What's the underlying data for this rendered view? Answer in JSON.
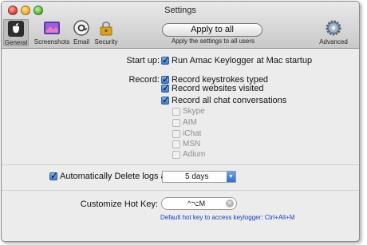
{
  "window": {
    "title": "Settings"
  },
  "toolbar": {
    "items": [
      {
        "label": "General",
        "icon": "apple-icon"
      },
      {
        "label": "Screenshots",
        "icon": "screenshot-icon"
      },
      {
        "label": "Email",
        "icon": "email-icon"
      },
      {
        "label": "Security",
        "icon": "lock-icon"
      },
      {
        "label": "Advanced",
        "icon": "gear-icon"
      }
    ],
    "apply_label": "Apply to all",
    "apply_caption": "Apply the settings to all users"
  },
  "startup": {
    "label": "Start up:",
    "option": "Run Amac Keylogger at Mac startup",
    "checked": true
  },
  "record": {
    "label": "Record:",
    "options": [
      {
        "label": "Record keystrokes typed",
        "checked": true
      },
      {
        "label": "Record websites visited",
        "checked": true
      },
      {
        "label": "Record all chat conversations",
        "checked": true
      }
    ],
    "chat_apps": [
      {
        "label": "Skype",
        "checked": false
      },
      {
        "label": "AIM",
        "checked": false
      },
      {
        "label": "iChat",
        "checked": false
      },
      {
        "label": "MSN",
        "checked": false
      },
      {
        "label": "Adium",
        "checked": false
      }
    ]
  },
  "auto_delete": {
    "label": "Automatically Delete logs after:",
    "checked": true,
    "value": "5 days"
  },
  "hotkey": {
    "label": "Customize Hot Key:",
    "value": "^⌥M",
    "hint": "Default hot key to access keylogger: Ctrl+Alt+M"
  },
  "colors": {
    "accent": "#3b78cf",
    "hint_text": "#1a3fb8"
  }
}
